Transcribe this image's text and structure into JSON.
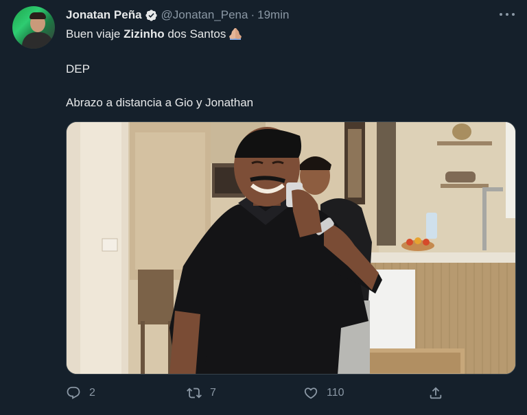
{
  "author": {
    "name": "Jonatan Peña",
    "handle": "@Jonatan_Pena",
    "separator": "·",
    "time": "19min",
    "verified": true
  },
  "tweet": {
    "line1_prefix": "Buen viaje ",
    "line1_bold": "Zizinho",
    "line1_suffix": " dos Santos",
    "line1_emoji": "folded-hands",
    "line2": "DEP",
    "line3": "Abrazo a distancia a Gio y Jonathan"
  },
  "media": {
    "type": "photo",
    "subject": "man-in-black-polo-on-phone-in-kitchen"
  },
  "actions": {
    "reply": {
      "icon": "reply-icon",
      "count": "2"
    },
    "retweet": {
      "icon": "retweet-icon",
      "count": "7"
    },
    "like": {
      "icon": "heart-icon",
      "count": "110"
    },
    "share": {
      "icon": "share-icon",
      "count": ""
    }
  },
  "colors": {
    "background": "#15202b",
    "text": "#e7e9ea",
    "muted": "#8b98a5",
    "verified": "#e7e9ea"
  }
}
